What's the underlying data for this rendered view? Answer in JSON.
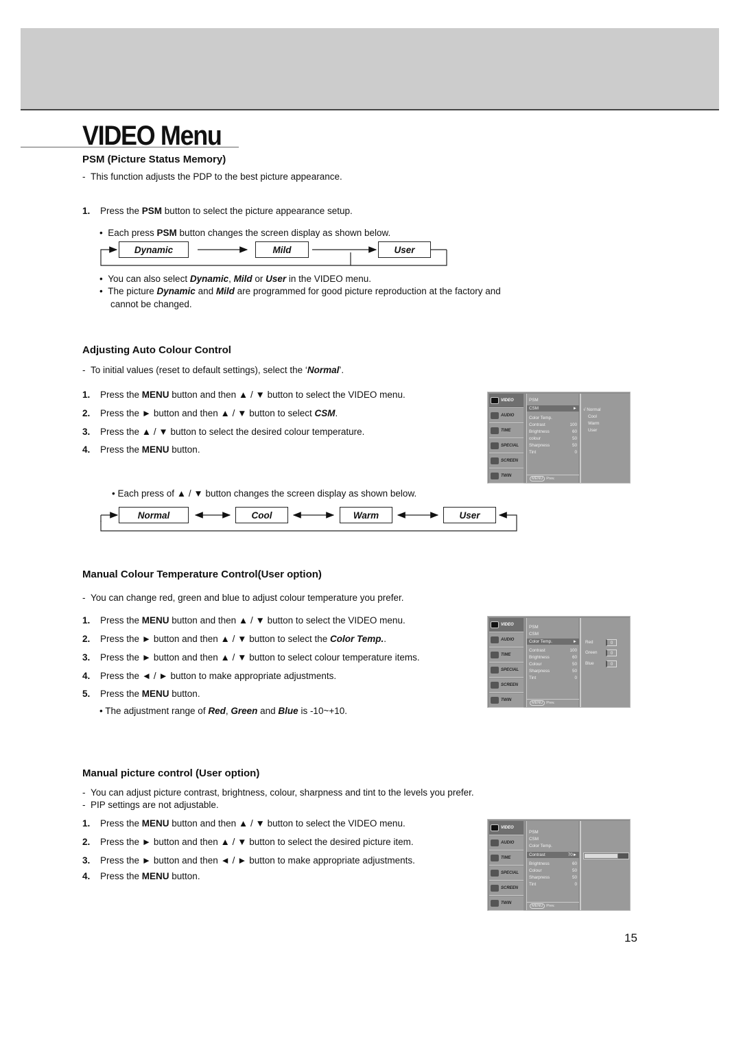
{
  "page": {
    "title": "VIDEO Menu",
    "page_number": "15"
  },
  "psm": {
    "heading": "PSM (Picture Status Memory)",
    "intro": "This function adjusts the PDP to the best picture appearance.",
    "step1": {
      "num": "1.",
      "pre": "Press the ",
      "bold": "PSM",
      "post": " button to select the picture appearance setup."
    },
    "bullet1": {
      "pre": "Each press ",
      "bold": "PSM",
      "post": " button changes the screen display as shown below."
    },
    "flow": [
      "Dynamic",
      "Mild",
      "User"
    ],
    "bullet2": {
      "a": "You can also select ",
      "b": "Dynamic",
      "c": ", ",
      "d": "Mild",
      "e": " or ",
      "f": "User",
      "g": " in the VIDEO menu."
    },
    "bullet3": {
      "a": "The picture ",
      "b": "Dynamic",
      "c": " and ",
      "d": "Mild",
      "e": " are programmed for good picture reproduction at the factory and",
      "f": "cannot be changed."
    }
  },
  "auto_colour": {
    "heading": "Adjusting Auto Colour Control",
    "intro": {
      "pre": "To initial values (reset to default settings), select the ‘",
      "bi": "Normal",
      "post": "’."
    },
    "steps": [
      {
        "num": "1.",
        "a": "Press the ",
        "b": "MENU",
        "c": " button and then ▲ / ▼  button to select the VIDEO menu."
      },
      {
        "num": "2.",
        "a": "Press the ► button and then ▲ / ▼ button to select ",
        "bi": "CSM",
        "c": "."
      },
      {
        "num": "3.",
        "a": "Press the ▲ / ▼ button to select the desired colour temperature."
      },
      {
        "num": "4.",
        "a": "Press the ",
        "b": "MENU",
        "c": " button."
      }
    ],
    "bullet": "• Each press of ▲ / ▼ button changes the screen display as shown below.",
    "flow": [
      "Normal",
      "Cool",
      "Warm",
      "User"
    ]
  },
  "manual_colour": {
    "heading": "Manual Colour Temperature Control(User option)",
    "intro": "You can change red, green and blue to adjust colour temperature you prefer.",
    "steps": [
      {
        "num": "1.",
        "a": "Press the ",
        "b": "MENU",
        "c": " button and then ▲ / ▼  button to select the VIDEO menu."
      },
      {
        "num": "2.",
        "a": "Press the ► button and then ▲ / ▼ button to select the ",
        "bi": "Color Temp.",
        "c": "."
      },
      {
        "num": "3.",
        "a": "Press the ► button and then ▲ / ▼ button to select colour temperature items."
      },
      {
        "num": "4.",
        "a": "Press the ◄ / ► button to make appropriate adjustments."
      },
      {
        "num": "5.",
        "a": "Press the ",
        "b": "MENU",
        "c": " button."
      }
    ],
    "note": {
      "a": "• The adjustment range of ",
      "b": "Red",
      "c": ", ",
      "d": "Green",
      "e": " and ",
      "f": "Blue",
      "g": " is -10~+10."
    }
  },
  "manual_picture": {
    "heading": "Manual picture control (User option)",
    "intro1": "You can adjust picture contrast, brightness, colour, sharpness and tint to the levels you prefer.",
    "intro2": "PIP settings are not adjustable.",
    "steps": [
      {
        "num": "1.",
        "a": "Press the ",
        "b": "MENU",
        "c": " button and then ▲ / ▼  button to select the VIDEO menu."
      },
      {
        "num": "2.",
        "a": "Press the ► button and then ▲ / ▼ button to select the desired picture item."
      },
      {
        "num": "3.",
        "a": "Press the ► button and then ◄ / ► button to make appropriate adjustments."
      },
      {
        "num": "4.",
        "a": "Press the ",
        "b": "MENU",
        "c": " button."
      }
    ]
  },
  "osd": {
    "sidebar": [
      "VIDEO",
      "AUDIO",
      "TIME",
      "SPECIAL",
      "SCREEN",
      "TWIN"
    ],
    "footer_key": "MENU",
    "footer_label": "Prev.",
    "menu1": {
      "items": [
        {
          "label": "PSM",
          "value": ""
        },
        {
          "label": "CSM",
          "value": "►"
        },
        {
          "label": "Color Temp.",
          "value": ""
        },
        {
          "label": "Contrast",
          "value": "100"
        },
        {
          "label": "Brightness",
          "value": "60"
        },
        {
          "label": "colour",
          "value": "50"
        },
        {
          "label": "Sharpness",
          "value": "50"
        },
        {
          "label": "Tint",
          "value": "0"
        }
      ],
      "options": [
        "√ Normal",
        "Cool",
        "Warm",
        "User"
      ]
    },
    "menu2": {
      "items": [
        {
          "label": "PSM",
          "value": ""
        },
        {
          "label": "CSM",
          "value": ""
        },
        {
          "label": "Color Temp.",
          "value": "►"
        },
        {
          "label": "Contrast",
          "value": "100"
        },
        {
          "label": "Brightness",
          "value": "60"
        },
        {
          "label": "Colour",
          "value": "50"
        },
        {
          "label": "Sharpness",
          "value": "50"
        },
        {
          "label": "Tint",
          "value": "0"
        }
      ],
      "rgb": [
        {
          "label": "Red",
          "value": "0"
        },
        {
          "label": "Green",
          "value": "0"
        },
        {
          "label": "Blue",
          "value": "0"
        }
      ]
    },
    "menu3": {
      "items": [
        {
          "label": "PSM",
          "value": ""
        },
        {
          "label": "CSM",
          "value": ""
        },
        {
          "label": "Color Temp.",
          "value": ""
        },
        {
          "label": "Contrast",
          "value": "70►"
        },
        {
          "label": "Brightness",
          "value": "60"
        },
        {
          "label": "Colour",
          "value": "50"
        },
        {
          "label": "Sharpness",
          "value": "50"
        },
        {
          "label": "Tint",
          "value": "0"
        }
      ],
      "contrast_level_percent": 70
    }
  }
}
